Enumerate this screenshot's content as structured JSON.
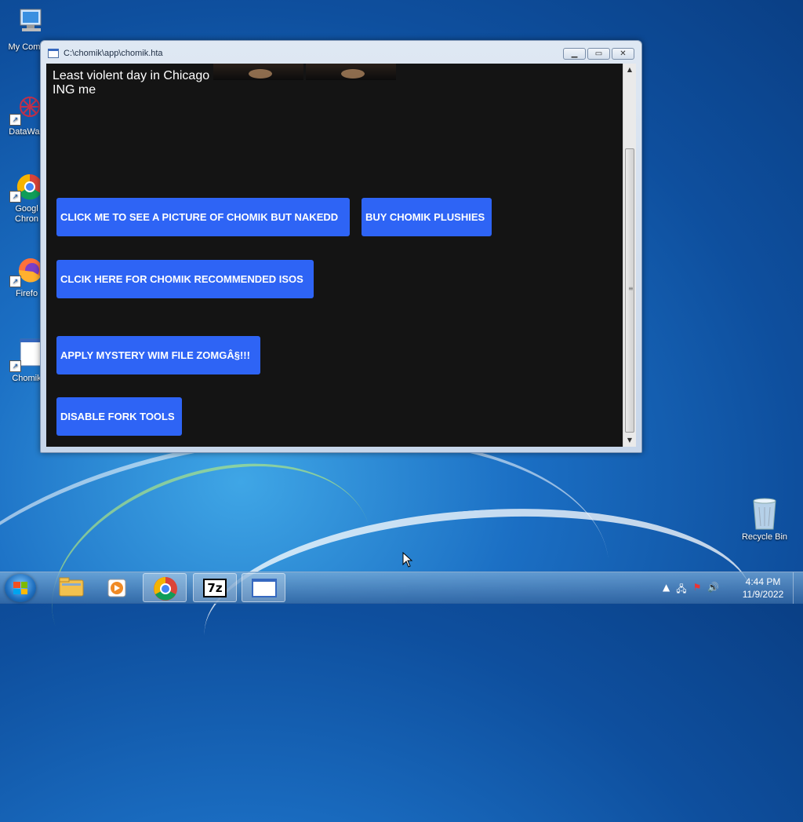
{
  "desktop": {
    "icons": [
      {
        "label": "My Comp",
        "icon": "computer-icon"
      },
      {
        "label": "DataWag",
        "icon": "datawag-icon"
      },
      {
        "label": "Googl\nChron",
        "icon": "chrome-icon"
      },
      {
        "label": "Firefo",
        "icon": "firefox-icon"
      },
      {
        "label": "Chomik",
        "icon": "hta-app-icon"
      },
      {
        "label": "Recycle Bin",
        "icon": "recycle-bin-icon"
      }
    ]
  },
  "window": {
    "title": "C:\\chomik\\app\\chomik.hta",
    "icon": "hta-app-icon",
    "content": {
      "line1": "Least violent day in Chicago",
      "line2": "ING me",
      "buttons": {
        "naked": "CLICK ME TO SEE A PICTURE OF CHOMIK BUT NAKEDD",
        "plushies": "BUY CHOMIK PLUSHIES",
        "isos": "CLCIK HERE FOR CHOMIK RECOMMENDED ISOS",
        "wim": "APPLY MYSTERY WIM FILE ZOMGÂ§!!!",
        "fork": "DISABLE FORK TOOLS"
      },
      "button_color": "#2e64f5",
      "background_color": "#141414"
    }
  },
  "taskbar": {
    "items": [
      {
        "name": "file-explorer",
        "icon": "folder-icon"
      },
      {
        "name": "media-player",
        "icon": "media-player-icon"
      },
      {
        "name": "google-chrome",
        "icon": "chrome-icon"
      },
      {
        "name": "7-zip",
        "icon": "7zip-icon",
        "text": "7z"
      },
      {
        "name": "chomik-hta",
        "icon": "hta-app-icon"
      }
    ],
    "clock": {
      "time": "4:44 PM",
      "date": "11/9/2022"
    }
  }
}
